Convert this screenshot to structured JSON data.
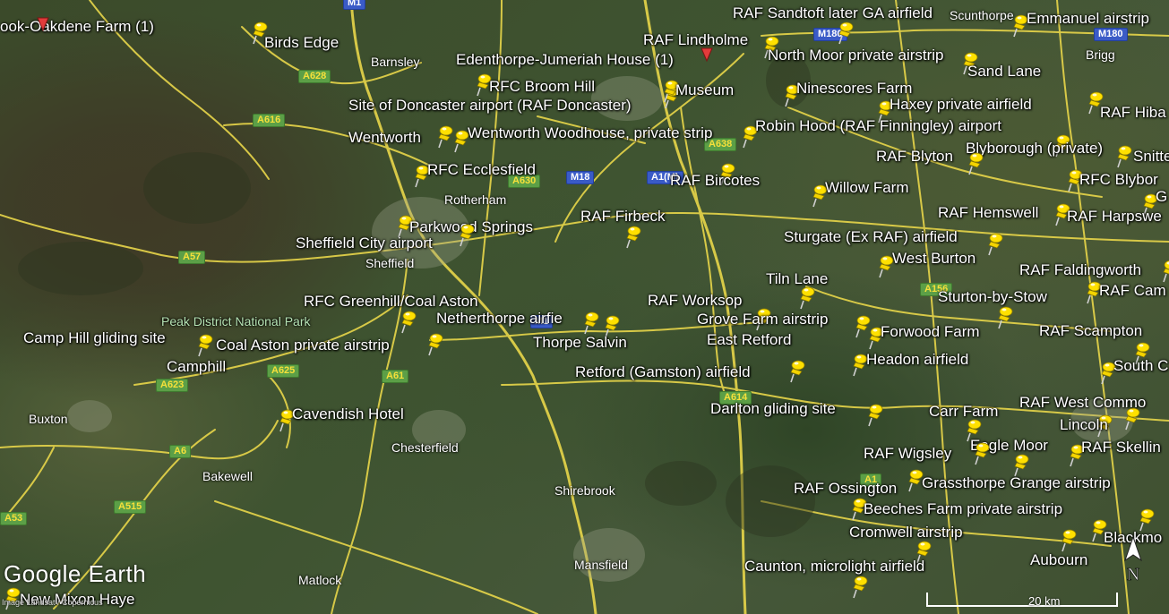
{
  "app": {
    "logo": "Google Earth",
    "credit": "Image Landsat / Copernicus"
  },
  "compass": {
    "letter": "N"
  },
  "scale": {
    "label": "20 km"
  },
  "park": {
    "label": "Peak District National Park"
  },
  "places": [
    {
      "id": "barnsley",
      "text": "Barnsley"
    },
    {
      "id": "rotherham",
      "text": "Rotherham"
    },
    {
      "id": "sheffield",
      "text": "Sheffield"
    },
    {
      "id": "brigg",
      "text": "Brigg"
    },
    {
      "id": "scunthorpe",
      "text": "Scunthorpe"
    },
    {
      "id": "buxton",
      "text": "Buxton"
    },
    {
      "id": "bakewell",
      "text": "Bakewell"
    },
    {
      "id": "chesterfield",
      "text": "Chesterfield"
    },
    {
      "id": "shirebrook",
      "text": "Shirebrook"
    },
    {
      "id": "mansfield",
      "text": "Mansfield"
    },
    {
      "id": "matlock",
      "text": "Matlock"
    }
  ],
  "roads": [
    {
      "id": "m1",
      "text": "M1",
      "kind": "m"
    },
    {
      "id": "m180a",
      "text": "M180",
      "kind": "m"
    },
    {
      "id": "m180b",
      "text": "M180",
      "kind": "m"
    },
    {
      "id": "m18",
      "text": "M18",
      "kind": "m"
    },
    {
      "id": "a1m",
      "text": "A1(M)",
      "kind": "m"
    },
    {
      "id": "m1b",
      "text": "M1",
      "kind": "m"
    },
    {
      "id": "a628",
      "text": "A628",
      "kind": "a"
    },
    {
      "id": "a616",
      "text": "A616",
      "kind": "a"
    },
    {
      "id": "a638",
      "text": "A638",
      "kind": "a"
    },
    {
      "id": "a630",
      "text": "A630",
      "kind": "a"
    },
    {
      "id": "a57",
      "text": "A57",
      "kind": "a"
    },
    {
      "id": "a625",
      "text": "A625",
      "kind": "a"
    },
    {
      "id": "a61",
      "text": "A61",
      "kind": "a"
    },
    {
      "id": "a623",
      "text": "A623",
      "kind": "a"
    },
    {
      "id": "a6",
      "text": "A6",
      "kind": "a"
    },
    {
      "id": "a515",
      "text": "A515",
      "kind": "a"
    },
    {
      "id": "a53",
      "text": "A53",
      "kind": "a"
    },
    {
      "id": "a614",
      "text": "A614",
      "kind": "a"
    },
    {
      "id": "a156",
      "text": "A156",
      "kind": "a"
    },
    {
      "id": "a1",
      "text": "A1",
      "kind": "a"
    }
  ],
  "placemarks": [
    {
      "id": "oakdene",
      "text": "ook-Oakdene Farm (1)"
    },
    {
      "id": "birds-edge",
      "text": "Birds Edge"
    },
    {
      "id": "edenthorpe",
      "text": "Edenthorpe-Jumeriah House (1)"
    },
    {
      "id": "rfc-broom-hill",
      "text": "RFC Broom Hill"
    },
    {
      "id": "doncaster",
      "text": "Site of Doncaster airport (RAF Doncaster)"
    },
    {
      "id": "wentworth",
      "text": "Wentworth"
    },
    {
      "id": "wentworth-woodhouse",
      "text": "Wentworth Woodhouse, private strip"
    },
    {
      "id": "rfc-ecclesfield",
      "text": "RFC Ecclesfield"
    },
    {
      "id": "parkwood",
      "text": "Parkwood Springs"
    },
    {
      "id": "sheffield-city",
      "text": "Sheffield City airport"
    },
    {
      "id": "rfc-greenhill",
      "text": "RFC Greenhill/Coal Aston"
    },
    {
      "id": "netherthorpe",
      "text": "Netherthorpe airfie"
    },
    {
      "id": "thorpe-salvin",
      "text": "Thorpe Salvin"
    },
    {
      "id": "camp-hill",
      "text": "Camp Hill gliding site"
    },
    {
      "id": "coal-aston",
      "text": "Coal Aston private airstrip"
    },
    {
      "id": "camphill",
      "text": "Camphill"
    },
    {
      "id": "cavendish",
      "text": "Cavendish Hotel"
    },
    {
      "id": "new-mixon",
      "text": "New Mixon Haye"
    },
    {
      "id": "raf-sandtoft",
      "text": "RAF Sandtoft later GA airfield"
    },
    {
      "id": "emmanuel",
      "text": "Emmanuel airstrip"
    },
    {
      "id": "raf-lindholme",
      "text": "RAF Lindholme"
    },
    {
      "id": "north-moor",
      "text": "North Moor private airstrip"
    },
    {
      "id": "sand-lane",
      "text": "Sand Lane"
    },
    {
      "id": "museum",
      "text": "Museum"
    },
    {
      "id": "ninescores",
      "text": "Ninescores Farm"
    },
    {
      "id": "haxey",
      "text": "Haxey private airfield"
    },
    {
      "id": "raf-hib",
      "text": "RAF Hiba"
    },
    {
      "id": "robin-hood",
      "text": "Robin Hood (RAF Finningley) airport"
    },
    {
      "id": "blyborough",
      "text": "Blyborough (private)"
    },
    {
      "id": "raf-blyton",
      "text": "RAF Blyton"
    },
    {
      "id": "snitter",
      "text": "Snitte"
    },
    {
      "id": "raf-bircotes",
      "text": "RAF Bircotes"
    },
    {
      "id": "rfc-blybor",
      "text": "RFC Blybor"
    },
    {
      "id": "willow-farm",
      "text": "Willow Farm"
    },
    {
      "id": "g-edge",
      "text": "G"
    },
    {
      "id": "raf-firbeck",
      "text": "RAF Firbeck"
    },
    {
      "id": "raf-hemswell",
      "text": "RAF Hemswell"
    },
    {
      "id": "raf-harpswell",
      "text": "RAF Harpswe"
    },
    {
      "id": "sturgate",
      "text": "Sturgate (Ex RAF) airfield"
    },
    {
      "id": "west-burton",
      "text": "West Burton"
    },
    {
      "id": "raf-faldingworth",
      "text": "RAF Faldingworth"
    },
    {
      "id": "tiln-lane",
      "text": "Tiln Lane"
    },
    {
      "id": "raf-cam",
      "text": "RAF Cam"
    },
    {
      "id": "raf-worksop",
      "text": "RAF Worksop"
    },
    {
      "id": "sturton",
      "text": "Sturton-by-Stow"
    },
    {
      "id": "grove-farm",
      "text": "Grove Farm airstrip"
    },
    {
      "id": "forwood",
      "text": "Forwood Farm"
    },
    {
      "id": "raf-scampton",
      "text": "RAF Scampton"
    },
    {
      "id": "east-retford",
      "text": "East Retford"
    },
    {
      "id": "headon",
      "text": "Headon airfield"
    },
    {
      "id": "south-c",
      "text": "South C"
    },
    {
      "id": "retford-gamston",
      "text": "Retford (Gamston) airfield"
    },
    {
      "id": "raf-west-common",
      "text": "RAF West Commo"
    },
    {
      "id": "darlton",
      "text": "Darlton gliding site"
    },
    {
      "id": "carr-farm",
      "text": "Carr Farm"
    },
    {
      "id": "lincoln",
      "text": "Lincoln"
    },
    {
      "id": "eagle-moor",
      "text": "Eagle Moor"
    },
    {
      "id": "raf-skelling",
      "text": "RAF Skellin"
    },
    {
      "id": "raf-wigsley",
      "text": "RAF Wigsley"
    },
    {
      "id": "grassthorpe",
      "text": "Grassthorpe Grange airstrip"
    },
    {
      "id": "raf-ossington",
      "text": "RAF Ossington"
    },
    {
      "id": "beeches",
      "text": "Beeches Farm private airstrip"
    },
    {
      "id": "cromwell",
      "text": "Cromwell airstrip"
    },
    {
      "id": "blackmo",
      "text": "Blackmo"
    },
    {
      "id": "aubourn",
      "text": "Aubourn"
    },
    {
      "id": "caunton",
      "text": "Caunton, microlight airfield"
    }
  ]
}
